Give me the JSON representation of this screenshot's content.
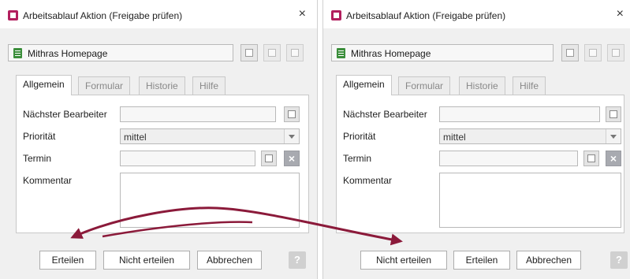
{
  "dialogs": [
    {
      "title": "Arbeitsablauf Aktion (Freigabe prüfen)",
      "close_glyph": "×",
      "object_name": "Mithras Homepage",
      "tabs": [
        "Allgemein",
        "Formular",
        "Historie",
        "Hilfe"
      ],
      "active_tab": "Allgemein",
      "fields": {
        "editor_label": "Nächster Bearbeiter",
        "editor_value": "",
        "priority_label": "Priorität",
        "priority_value": "mittel",
        "deadline_label": "Termin",
        "deadline_value": "",
        "comment_label": "Kommentar",
        "comment_value": ""
      },
      "buttons": [
        "Erteilen",
        "Nicht erteilen",
        "Abbrechen"
      ],
      "help_label": "?"
    },
    {
      "title": "Arbeitsablauf Aktion (Freigabe prüfen)",
      "close_glyph": "×",
      "object_name": "Mithras Homepage",
      "tabs": [
        "Allgemein",
        "Formular",
        "Historie",
        "Hilfe"
      ],
      "active_tab": "Allgemein",
      "fields": {
        "editor_label": "Nächster Bearbeiter",
        "editor_value": "",
        "priority_label": "Priorität",
        "priority_value": "mittel",
        "deadline_label": "Termin",
        "deadline_value": "",
        "comment_label": "Kommentar",
        "comment_value": ""
      },
      "buttons": [
        "Nicht erteilen",
        "Erteilen",
        "Abbrechen"
      ],
      "help_label": "?"
    }
  ],
  "colors": {
    "app_icon": "#b21f5e",
    "object_icon": "#3b8e3b",
    "swap_arrows": "#8b1a3a"
  },
  "icons": {
    "app": "workflow-app-icon",
    "object": "page-object-icon",
    "user_picker": "user-picker-icon",
    "calendar": "calendar-icon",
    "clear": "clear-x-icon",
    "help": "help-icon",
    "annotation": "swap-arrows-icon"
  }
}
